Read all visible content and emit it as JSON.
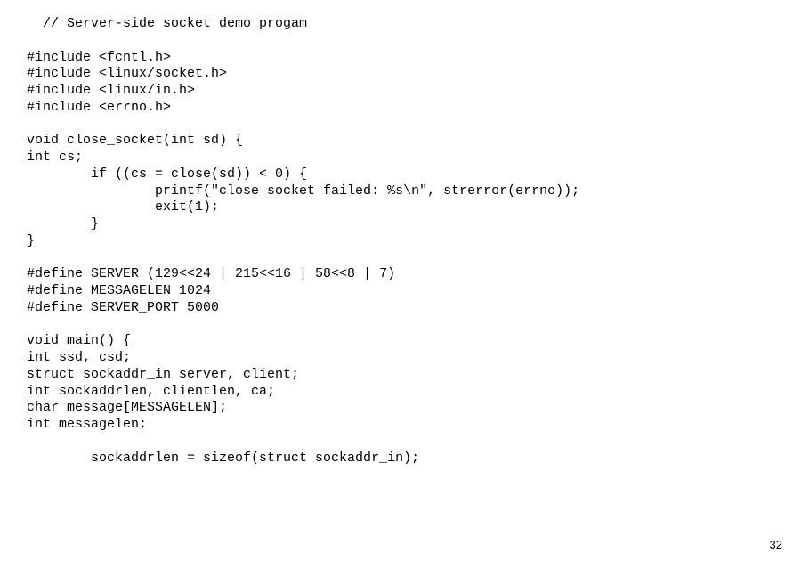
{
  "code": {
    "lines": [
      "  // Server-side socket demo progam",
      "",
      "#include <fcntl.h>",
      "#include <linux/socket.h>",
      "#include <linux/in.h>",
      "#include <errno.h>",
      "",
      "void close_socket(int sd) {",
      "int cs;",
      "        if ((cs = close(sd)) < 0) {",
      "                printf(\"close socket failed: %s\\n\", strerror(errno));",
      "                exit(1);",
      "        }",
      "}",
      "",
      "#define SERVER (129<<24 | 215<<16 | 58<<8 | 7)",
      "#define MESSAGELEN 1024",
      "#define SERVER_PORT 5000",
      "",
      "void main() {",
      "int ssd, csd;",
      "struct sockaddr_in server, client;",
      "int sockaddrlen, clientlen, ca;",
      "char message[MESSAGELEN];",
      "int messagelen;",
      "",
      "        sockaddrlen = sizeof(struct sockaddr_in);"
    ]
  },
  "page_number": "32"
}
